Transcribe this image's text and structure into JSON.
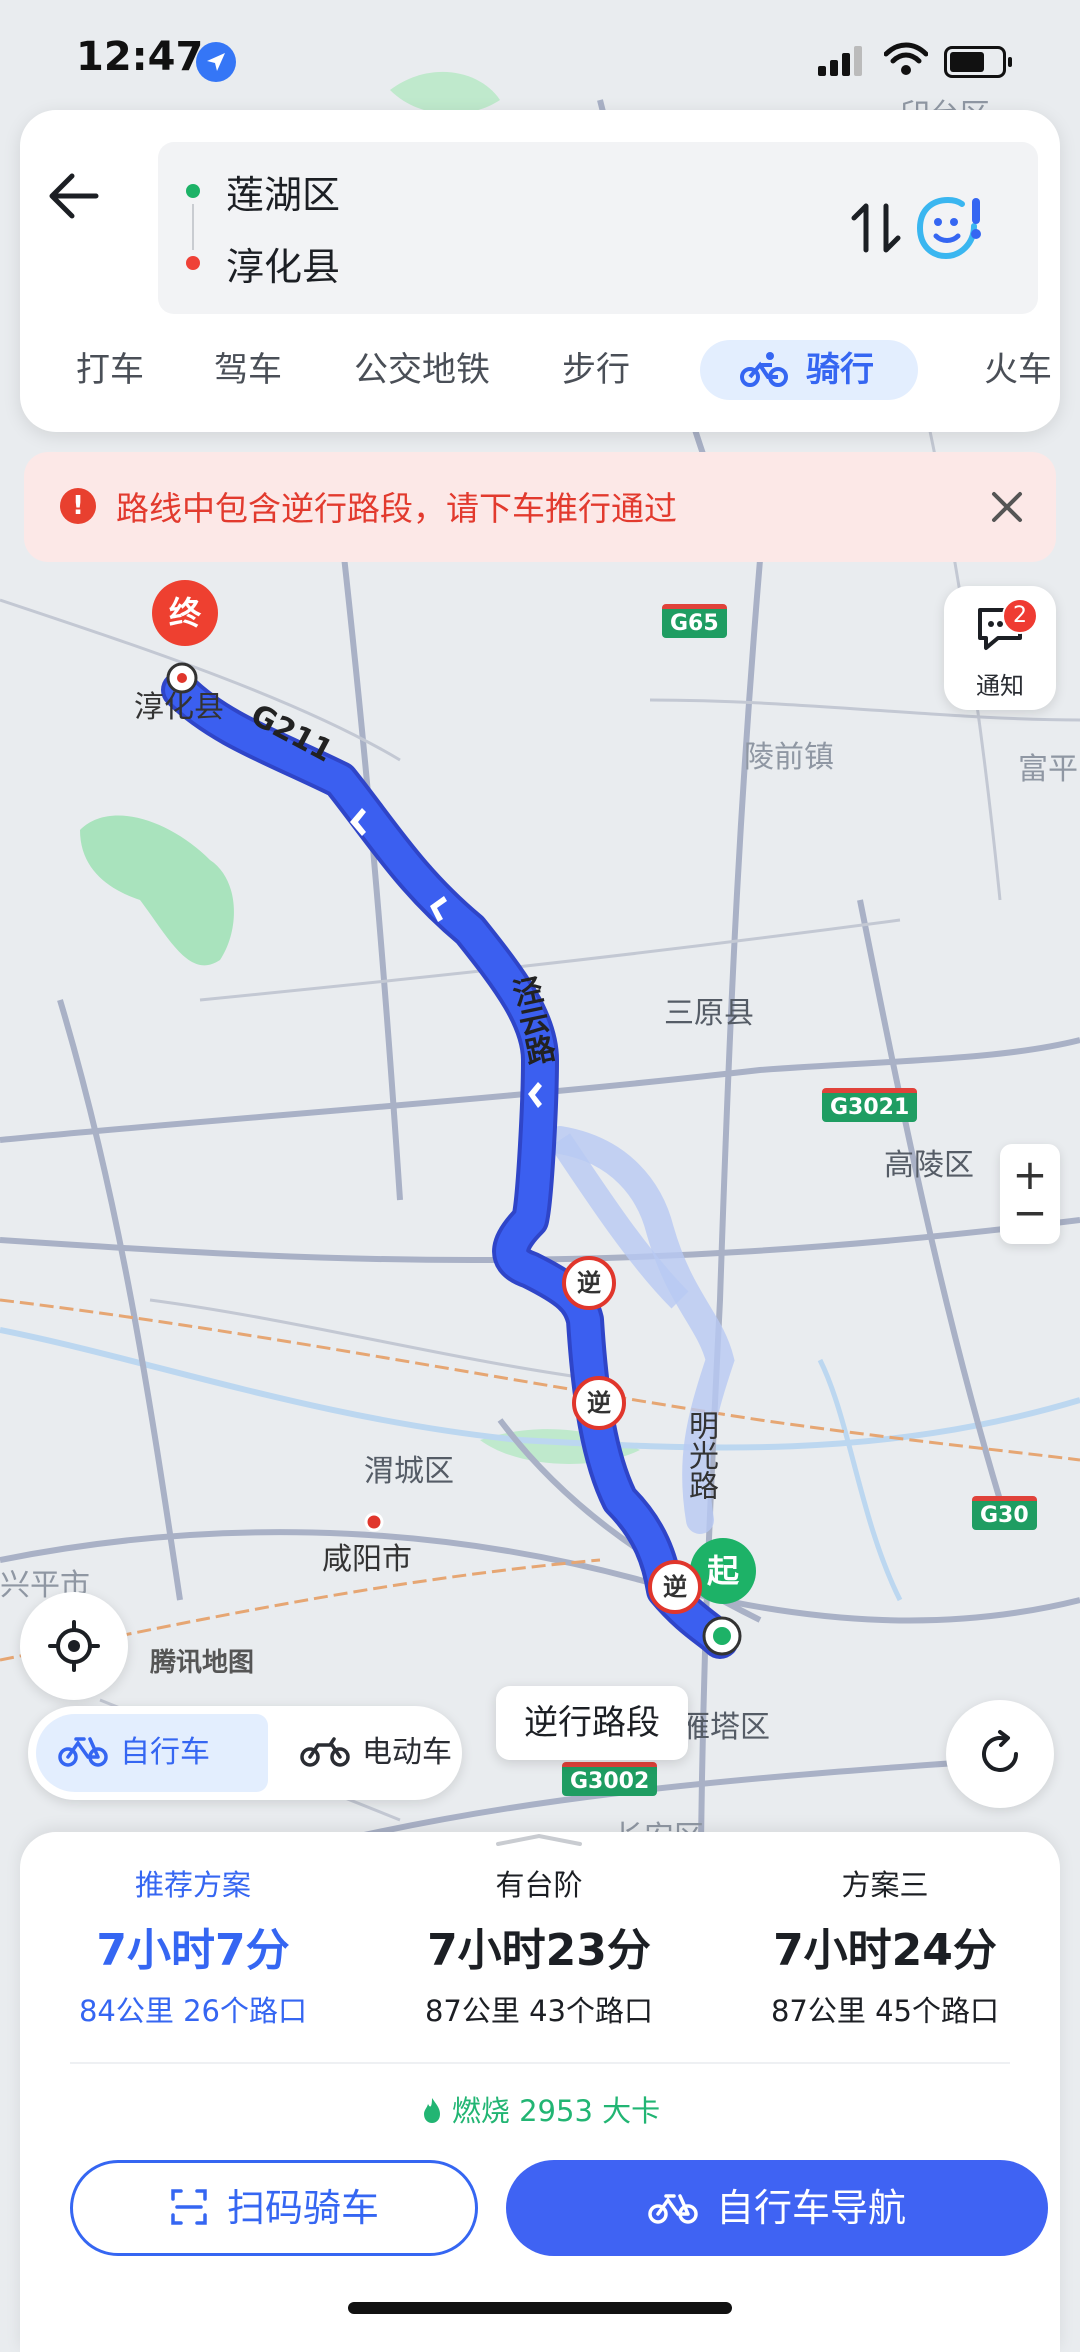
{
  "status_bar": {
    "time": "12:47"
  },
  "search": {
    "start": "莲湖区",
    "end": "淳化县"
  },
  "modes": [
    "打车",
    "驾车",
    "公交地铁",
    "步行",
    "骑行",
    "火车"
  ],
  "active_mode": "骑行",
  "warning": {
    "text": "路线中包含逆行路段，请下车推行通过"
  },
  "notification": {
    "label": "通知",
    "count": "2"
  },
  "map": {
    "labels": {
      "end_marker": "终",
      "start_marker": "起",
      "chunhua": "淳化县",
      "g211": "G211",
      "jingyun": "泾云路",
      "lingqian": "陵前镇",
      "fuping": "富平",
      "sanyuan": "三原县",
      "gaoling": "高陵区",
      "weicheng": "渭城区",
      "xianyang": "咸阳市",
      "mingguang": "明光路",
      "yanta": "雁塔区",
      "changan": "长安区",
      "xingping": "兴平市",
      "yaozhou": "印台区",
      "reverse": "逆",
      "attribution": "腾讯地图"
    },
    "highways": [
      "G65",
      "G3021",
      "G30",
      "G3002"
    ]
  },
  "vehicle_toggle": {
    "bike": "自行车",
    "ebike": "电动车"
  },
  "reverse_callout": "逆行路段",
  "plans": [
    {
      "tag": "推荐方案",
      "duration": "7小时7分",
      "meta": "84公里 26个路口",
      "selected": true
    },
    {
      "tag": "有台阶",
      "duration": "7小时23分",
      "meta": "87公里 43个路口",
      "selected": false
    },
    {
      "tag": "方案三",
      "duration": "7小时24分",
      "meta": "87公里 45个路口",
      "selected": false
    }
  ],
  "calorie": "燃烧 2953 大卡",
  "buttons": {
    "scan": "扫码骑车",
    "navigate": "自行车导航"
  },
  "colors": {
    "accent": "#3566f2",
    "route": "#3b5ff0",
    "warning": "#e23a2e",
    "calorie": "#22b573"
  }
}
